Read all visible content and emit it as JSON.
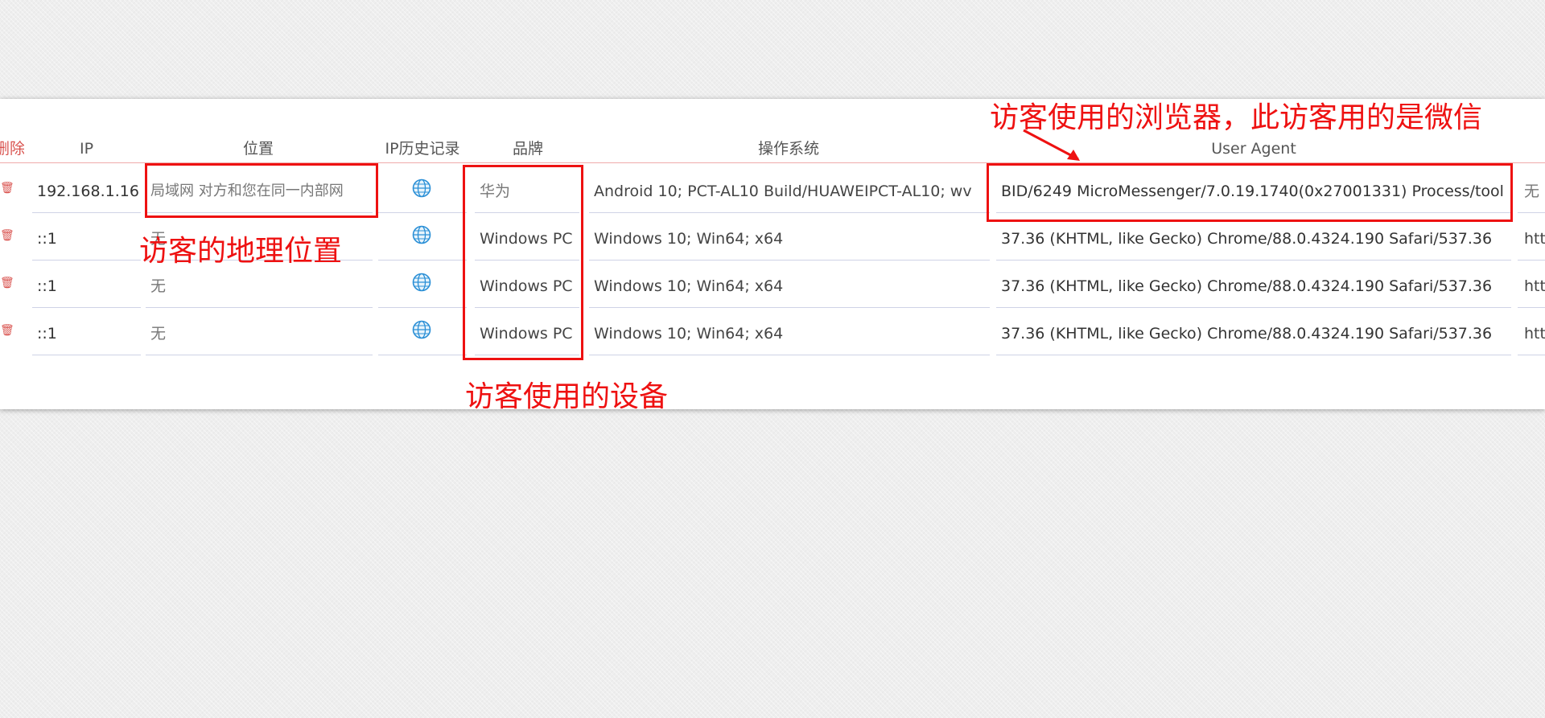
{
  "table": {
    "headers": {
      "delete": "删除",
      "ip": "IP",
      "location": "位置",
      "ip_history": "IP历史记录",
      "brand": "品牌",
      "os": "操作系统",
      "user_agent": "User Agent"
    },
    "rows": [
      {
        "ip": "192.168.1.16",
        "location": "局域网 对方和您在同一内部网",
        "brand": "华为",
        "os": "Android 10; PCT-AL10 Build/HUAWEIPCT-AL10; wv",
        "user_agent": "BID/6249 MicroMessenger/7.0.19.1740(0x27001331) Process/tool",
        "extra": "无"
      },
      {
        "ip": "::1",
        "location": "无",
        "brand": "Windows PC",
        "os": "Windows 10; Win64; x64",
        "user_agent": "37.36 (KHTML, like Gecko) Chrome/88.0.4324.190 Safari/537.36",
        "extra": "htt"
      },
      {
        "ip": "::1",
        "location": "无",
        "brand": "Windows PC",
        "os": "Windows 10; Win64; x64",
        "user_agent": "37.36 (KHTML, like Gecko) Chrome/88.0.4324.190 Safari/537.36",
        "extra": "htt"
      },
      {
        "ip": "::1",
        "location": "无",
        "brand": "Windows PC",
        "os": "Windows 10; Win64; x64",
        "user_agent": "37.36 (KHTML, like Gecko) Chrome/88.0.4324.190 Safari/537.36",
        "extra": "htt"
      }
    ]
  },
  "annotations": {
    "location": "访客的地理位置",
    "device": "访客使用的设备",
    "browser": "访客使用的浏览器，此访客用的是微信"
  },
  "icons": {
    "delete": "trash-icon",
    "history": "globe-icon"
  },
  "colors": {
    "annotation_red": "#ee1111",
    "header_delete": "#d9534f",
    "globe_blue": "#2a8fd6"
  }
}
